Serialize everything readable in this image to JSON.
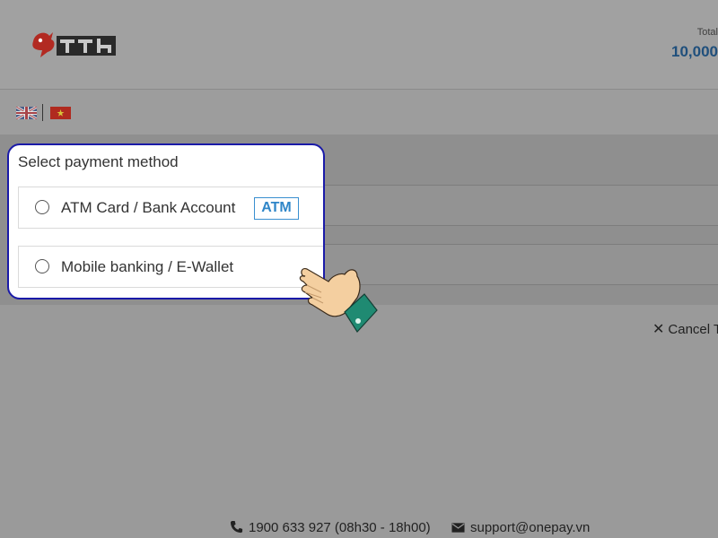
{
  "header": {
    "total_label": "Total",
    "total_amount": "10,000"
  },
  "language": {
    "options": [
      "English",
      "Tiếng Việt"
    ]
  },
  "payment": {
    "title": "Select payment method",
    "options": [
      {
        "label": "ATM Card / Bank Account",
        "badge": "ATM"
      },
      {
        "label": "Mobile banking / E-Wallet"
      }
    ]
  },
  "actions": {
    "cancel_label": "Cancel T"
  },
  "footer": {
    "phone": "1900 633 927 (08h30 - 18h00)",
    "email": "support@onepay.vn"
  },
  "colors": {
    "highlight_border": "#1a1aa8",
    "amount": "#1f4f7c",
    "atm_badge": "#2f86c8"
  },
  "icons": [
    "merchant-logo-icon",
    "uk-flag-icon",
    "vietnam-flag-icon",
    "close-icon",
    "phone-icon",
    "mail-icon",
    "pointing-hand-icon"
  ]
}
